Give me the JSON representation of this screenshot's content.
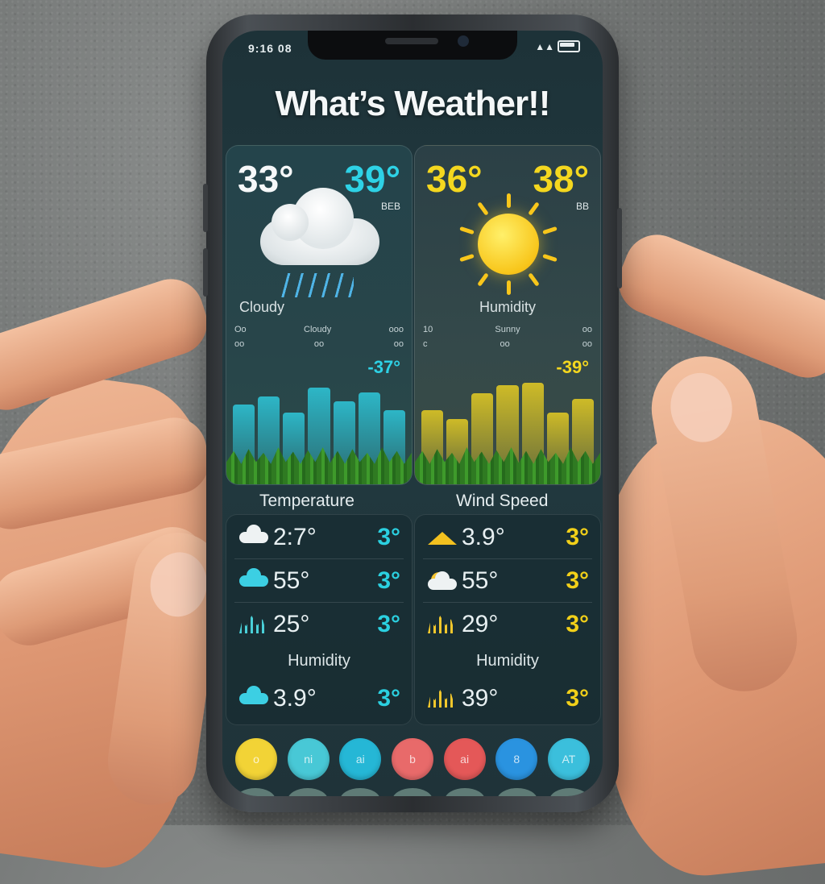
{
  "status_bar": {
    "time": "9:16 08"
  },
  "app": {
    "title": "What’s Weather!!"
  },
  "cards": {
    "left": {
      "temp_main": "33°",
      "temp_alt": "39°",
      "code": "BEB",
      "condition": "Cloudy",
      "row1_a": "Oo",
      "row1_b": "Cloudy",
      "row1_c": "ooo",
      "row2_a": "oo",
      "row2_b": "oo",
      "row2_c": "oo",
      "peak": "-37°",
      "accent": "#2ed2e6",
      "bars": [
        0.55,
        0.62,
        0.48,
        0.7,
        0.58,
        0.66,
        0.5
      ]
    },
    "right": {
      "temp_main": "36°",
      "temp_alt": "38°",
      "code": "BB",
      "condition": "Humidity",
      "row1_a": "10",
      "row1_b": "Sunny",
      "row1_c": "oo",
      "row2_a": "c",
      "row2_b": "oo",
      "row2_c": "oo",
      "peak": "-39°",
      "accent": "#f4d71f",
      "bars": [
        0.5,
        0.42,
        0.65,
        0.72,
        0.74,
        0.48,
        0.6
      ]
    }
  },
  "labels": {
    "left": "Temperature",
    "right": "Wind Speed"
  },
  "forecast_left": {
    "rows": [
      {
        "icon": "cloud-white-icon",
        "temp": "2:7°",
        "value": "3°"
      },
      {
        "icon": "cloud-cyan-icon",
        "temp": "55°",
        "value": "3°"
      },
      {
        "icon": "sprout-cyan-icon",
        "temp": "25°",
        "value": "3°"
      },
      {
        "icon": "cloud-cyan-icon",
        "temp": "3.9°",
        "value": "3°"
      }
    ],
    "humidity": "Humidity",
    "color": "#2bd0e0"
  },
  "forecast_right": {
    "rows": [
      {
        "icon": "mountain-yellow-icon",
        "temp": "3.9°",
        "value": "3°"
      },
      {
        "icon": "sun-cloud-icon",
        "temp": "55°",
        "value": "3°"
      },
      {
        "icon": "sprout-yellow-icon",
        "temp": "29°",
        "value": "3°"
      },
      {
        "icon": "sprout-yellow-icon",
        "temp": "39°",
        "value": "3°"
      }
    ],
    "humidity": "Humidity",
    "color": "#f2d019"
  },
  "dock": [
    {
      "color": "#f2d336",
      "label": "o"
    },
    {
      "color": "#48c8d6",
      "label": "ni"
    },
    {
      "color": "#25b7d6",
      "label": "ai"
    },
    {
      "color": "#e86a6a",
      "label": "b"
    },
    {
      "color": "#e45858",
      "label": "ai"
    },
    {
      "color": "#2a93e0",
      "label": "8"
    },
    {
      "color": "#3bbfdc",
      "label": "AT"
    }
  ]
}
